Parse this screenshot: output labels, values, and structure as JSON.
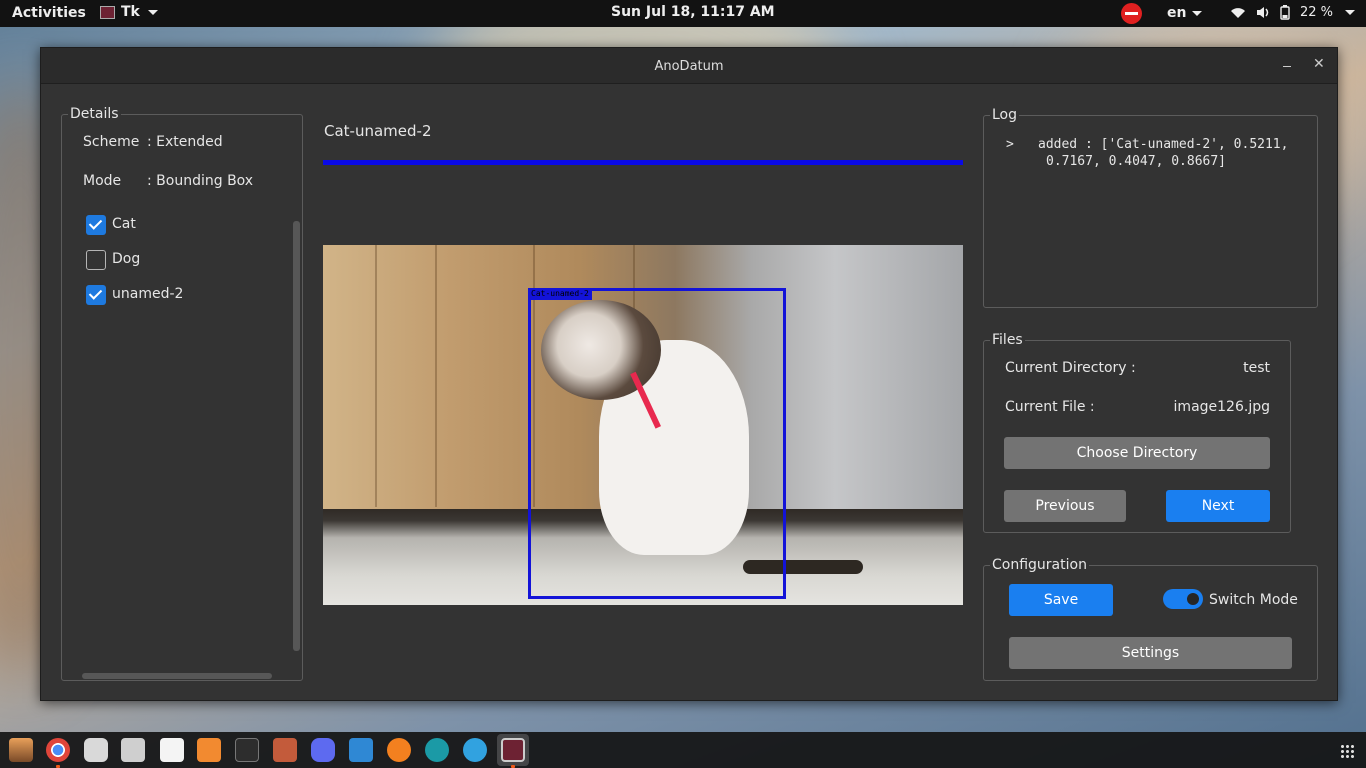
{
  "topbar": {
    "activities": "Activities",
    "app_menu": "Tk",
    "clock": "Sun Jul 18, 11:17 AM",
    "language": "en",
    "battery": "22 %"
  },
  "window": {
    "title": "AnoDatum"
  },
  "details": {
    "legend": "Details",
    "scheme_label": "Scheme",
    "scheme_value": ": Extended",
    "mode_label": "Mode",
    "mode_value": ": Bounding Box",
    "classes": [
      {
        "label": "Cat",
        "checked": true
      },
      {
        "label": "Dog",
        "checked": false
      },
      {
        "label": "unamed-2",
        "checked": true
      }
    ]
  },
  "main": {
    "image_title": "Cat-unamed-2",
    "progress": 1.0,
    "bbox_label": "Cat-unamed-2"
  },
  "log": {
    "legend": "Log",
    "prompt": ">",
    "line1": "added : ['Cat-unamed-2', 0.5211,",
    "line2": "0.7167, 0.4047, 0.8667]"
  },
  "files": {
    "legend": "Files",
    "dir_label": "Current Directory :",
    "dir_value": "test",
    "file_label": "Current File :",
    "file_value": "image126.jpg",
    "choose_dir": "Choose Directory",
    "previous": "Previous",
    "next": "Next"
  },
  "config": {
    "legend": "Configuration",
    "save": "Save",
    "switch_mode": "Switch Mode",
    "switch_on": true,
    "settings": "Settings"
  },
  "colors": {
    "accent": "#1a7ff0",
    "bbox": "#1313d8",
    "progress": "#0a0ae6",
    "window_bg": "#333333"
  },
  "dock": {
    "icons": [
      "files-icon",
      "chrome-icon",
      "disk-icon",
      "calculator-icon",
      "text-editor-icon",
      "software-center-icon",
      "terminal-icon",
      "tweaks-icon",
      "discord-icon",
      "vscode-icon",
      "ubuntu-icon",
      "arduino-icon",
      "telegram-icon",
      "tk-app-icon",
      "show-apps-icon"
    ]
  }
}
